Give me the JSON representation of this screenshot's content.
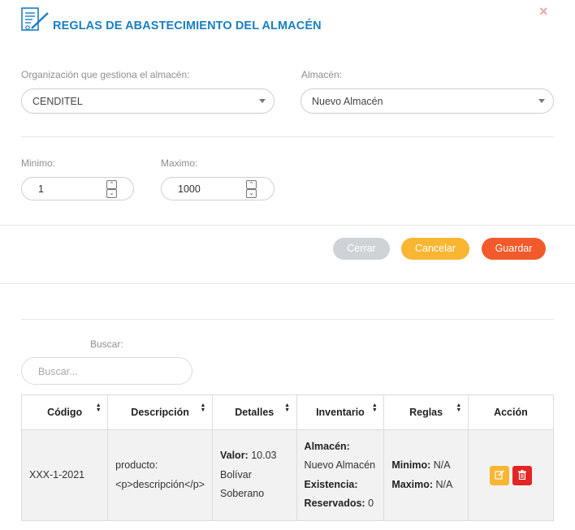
{
  "modal": {
    "title": "REGLAS DE ABASTECIMIENTO DEL ALMACÉN",
    "close_glyph": "×",
    "accent_color": "#1a7fc1"
  },
  "form": {
    "org_label": "Organización que gestiona el almacén:",
    "org_value": "CENDITEL",
    "warehouse_label": "Almacén:",
    "warehouse_value": "Nuevo Almacén",
    "min_label": "Minimo:",
    "min_value": "1",
    "max_label": "Maximo:",
    "max_value": "1000"
  },
  "buttons": {
    "close": "Cerrar",
    "cancel": "Cancelar",
    "save": "Guardar"
  },
  "search": {
    "label": "Buscar:",
    "placeholder": "Buscar..."
  },
  "table": {
    "headers": [
      "Código",
      "Descripción",
      "Detalles",
      "Inventario",
      "Reglas",
      "Acción"
    ],
    "rows": [
      {
        "code": "XXX-1-2021",
        "description_line1": "producto:",
        "description_line2": "<p>descripción</p>",
        "details_label": "Valor:",
        "details_value": "10.03",
        "details_line2": "Bolívar",
        "details_line3": "Soberano",
        "inv_warehouse_label": "Almacén:",
        "inv_warehouse_value": "Nuevo Almacén",
        "inv_stock_label": "Existencia:",
        "inv_reserved_label": "Reservados:",
        "inv_reserved_value": "0",
        "rule_min_label": "Minimo:",
        "rule_min_value": "N/A",
        "rule_max_label": "Maximo:",
        "rule_max_value": "N/A"
      }
    ]
  },
  "icons": {
    "header": "document-pen-icon",
    "edit": "edit-icon",
    "delete": "trash-icon",
    "sort": "sort-icon",
    "caret": "chevron-down-icon"
  }
}
